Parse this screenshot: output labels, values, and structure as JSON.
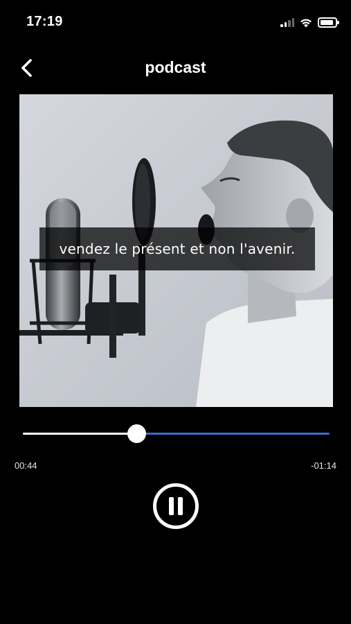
{
  "status_bar": {
    "time": "17:19",
    "icons": [
      "signal-icon",
      "wifi-icon",
      "battery-icon"
    ]
  },
  "nav": {
    "back_icon": "chevron-left-icon",
    "title": "podcast"
  },
  "artwork": {
    "caption": "vendez le présent et non l'avenir.",
    "description_icon": "podcast-cover-image"
  },
  "player": {
    "progress_fraction": 0.37,
    "elapsed": "00:44",
    "remaining": "-01:14",
    "pause_icon": "pause-icon",
    "played_color": "#ffffff",
    "remaining_color": "#3c6bd2"
  }
}
